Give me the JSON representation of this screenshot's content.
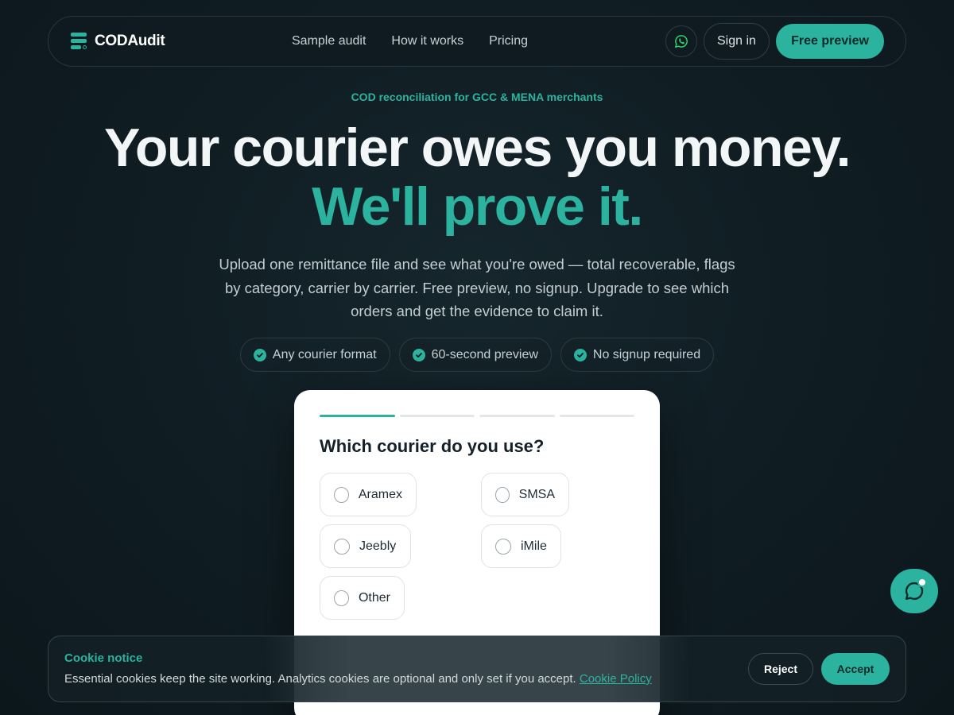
{
  "brand": {
    "name": "CODAudit"
  },
  "nav": {
    "links": [
      "Sample audit",
      "How it works",
      "Pricing"
    ],
    "whatsapp_icon": "whatsapp-icon",
    "signin_label": "Sign in",
    "cta_label": "Free preview"
  },
  "hero": {
    "eyebrow": "COD reconciliation for GCC & MENA merchants",
    "title_line1": "Your courier owes you money.",
    "title_line2": "We'll prove it.",
    "subtitle": "Upload one remittance file and see what you're owed — total recoverable, flags by category, carrier by carrier. Free preview, no signup. Upgrade to see which orders and get the evidence to claim it.",
    "pills": [
      "Any courier format",
      "60-second preview",
      "No signup required"
    ]
  },
  "wizard": {
    "steps_total": 4,
    "current_step": 1,
    "question": "Which courier do you use?",
    "options": [
      "Aramex",
      "SMSA",
      "Jeebly",
      "iMile",
      "Other"
    ]
  },
  "cookie": {
    "title": "Cookie notice",
    "text": "Essential cookies keep the site working. Analytics cookies are optional and only set if you accept.",
    "link_label": "Cookie Policy",
    "reject_label": "Reject",
    "accept_label": "Accept"
  },
  "colors": {
    "accent": "#2bb3a0",
    "background": "#0f1c22",
    "card": "#ffffff"
  }
}
